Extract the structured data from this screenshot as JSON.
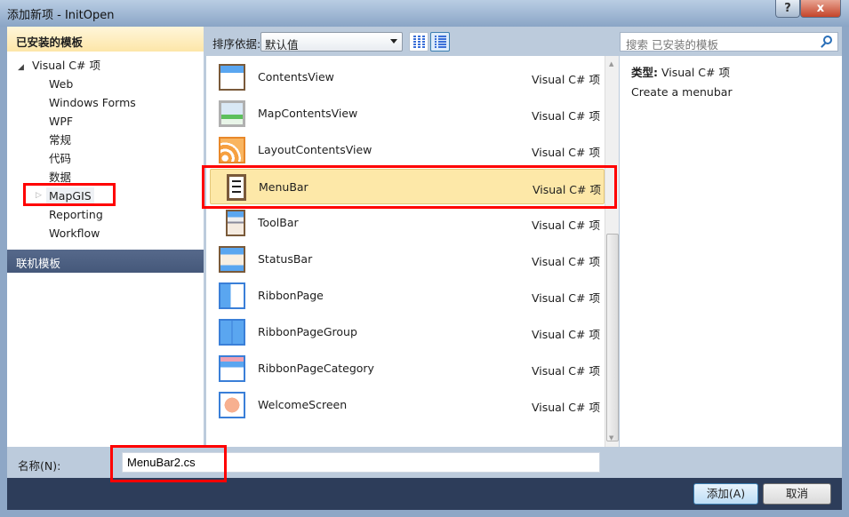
{
  "window": {
    "title": "添加新项 - InitOpen",
    "help_label": "?",
    "close_label": "x"
  },
  "sidebar": {
    "header": "已安装的模板",
    "root": "Visual C# 项",
    "items": [
      {
        "label": "Web"
      },
      {
        "label": "Windows Forms"
      },
      {
        "label": "WPF"
      },
      {
        "label": "常规"
      },
      {
        "label": "代码"
      },
      {
        "label": "数据"
      },
      {
        "label": "MapGIS"
      },
      {
        "label": "Reporting"
      },
      {
        "label": "Workflow"
      }
    ],
    "online": "联机模板"
  },
  "toolbar": {
    "sort_label": "排序依据:",
    "sort_value": "默认值",
    "search_placeholder": "搜索 已安装的模板"
  },
  "templates": [
    {
      "name": "ContentsView",
      "type": "Visual C# 项",
      "icon": "contents-view-icon"
    },
    {
      "name": "MapContentsView",
      "type": "Visual C# 项",
      "icon": "map-contents-view-icon"
    },
    {
      "name": "LayoutContentsView",
      "type": "Visual C# 项",
      "icon": "layout-contents-view-icon"
    },
    {
      "name": "MenuBar",
      "type": "Visual C# 项",
      "icon": "menubar-icon",
      "selected": true
    },
    {
      "name": "ToolBar",
      "type": "Visual C# 项",
      "icon": "toolbar-icon"
    },
    {
      "name": "StatusBar",
      "type": "Visual C# 项",
      "icon": "statusbar-icon"
    },
    {
      "name": "RibbonPage",
      "type": "Visual C# 项",
      "icon": "ribbon-page-icon"
    },
    {
      "name": "RibbonPageGroup",
      "type": "Visual C# 项",
      "icon": "ribbon-page-group-icon"
    },
    {
      "name": "RibbonPageCategory",
      "type": "Visual C# 项",
      "icon": "ribbon-page-category-icon"
    },
    {
      "name": "WelcomeScreen",
      "type": "Visual C# 项",
      "icon": "welcome-screen-icon"
    }
  ],
  "details": {
    "type_label": "类型:",
    "type_value": "Visual C# 项",
    "description": "Create a menubar"
  },
  "name_field": {
    "label": "名称(N):",
    "value": "MenuBar2.cs"
  },
  "buttons": {
    "add": "添加(A)",
    "cancel": "取消"
  },
  "colors": {
    "highlight": "#ff0000",
    "selection": "#fde8a8"
  }
}
